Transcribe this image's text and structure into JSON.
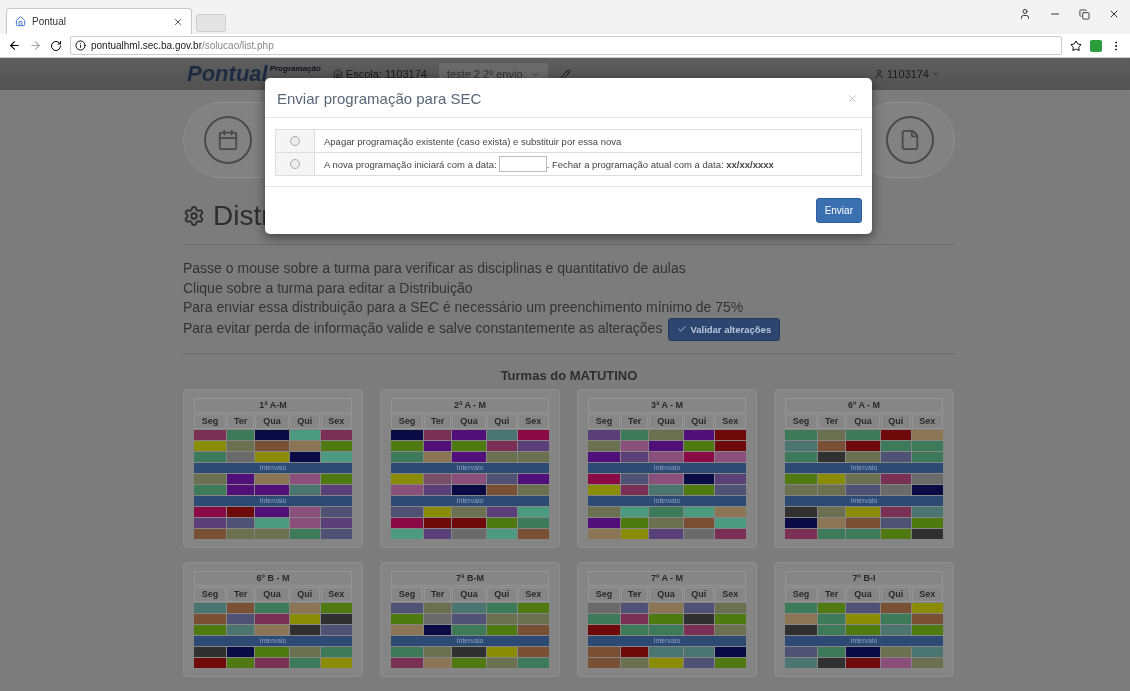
{
  "browser": {
    "tab_title": "Pontual",
    "url_host": "pontualhml.sec.ba.gov.br",
    "url_path": "/solucao/list.php"
  },
  "navbar": {
    "brand": "Pontual",
    "brand_sub": "Programação",
    "school": "Escola: 1103174",
    "select_value": "teste 2 2º envio",
    "user": "1103174"
  },
  "heading": "Distr",
  "instructions": [
    "Passe o mouse sobre a turma para verificar as disciplinas e quantitativo de aulas",
    "Clique sobre a turma para editar a Distribuição",
    "Para enviar essa distribuição para a SEC é necessário um preenchimento mínimo de 75%",
    "Para evitar perda de informação valide e salve constantemente as alterações"
  ],
  "validate_button": "Validar alterações",
  "section_title": "Turmas do MATUTINO",
  "cards": [
    {
      "title": "1ª A-M",
      "days": [
        "Seg",
        "Ter",
        "Qua",
        "Qui",
        "Sex"
      ],
      "rows": [
        {
          "kind": "slot",
          "cells": [
            {
              "color": "#7a2f55"
            },
            {
              "color": "#3d7a5a"
            },
            {
              "color": "#0a0a45"
            },
            {
              "color": "#4c9a80"
            },
            {
              "color": "#7a2f55"
            }
          ]
        },
        {
          "kind": "slot",
          "cells": [
            {
              "color": "#8a8c05"
            },
            {
              "color": "#6a7050"
            },
            {
              "color": "#7a5035"
            },
            {
              "color": "#8c7555"
            },
            {
              "color": "#4f7a12"
            }
          ]
        },
        {
          "kind": "slot",
          "cells": [
            {
              "color": "#3d7a5a"
            },
            {
              "color": "#6a6a6a"
            },
            {
              "color": "#8a8c05"
            },
            {
              "color": "#0a0a45"
            },
            {
              "color": "#4c9a80"
            }
          ]
        },
        {
          "kind": "break",
          "label": "Intervalo"
        },
        {
          "kind": "slot",
          "cells": [
            {
              "color": "#6a7050"
            },
            {
              "color": "#510f7a"
            },
            {
              "color": "#8c7555"
            },
            {
              "color": "#8a4f7a"
            },
            {
              "color": "#4f7a12"
            }
          ]
        },
        {
          "kind": "slot",
          "cells": [
            {
              "color": "#3d7a5a"
            },
            {
              "color": "#510f7a"
            },
            {
              "color": "#510f7a"
            },
            {
              "color": "#4a7570"
            },
            {
              "color": "#5a3f78"
            }
          ]
        },
        {
          "kind": "break",
          "label": "Intervalo"
        },
        {
          "kind": "slot",
          "cells": [
            {
              "color": "#8a0a45"
            },
            {
              "color": "#6e0a0a"
            },
            {
              "color": "#510f7a"
            },
            {
              "color": "#8a4f7a"
            },
            {
              "color": "#4f5275"
            }
          ]
        },
        {
          "kind": "slot",
          "cells": [
            {
              "color": "#5a3f78"
            },
            {
              "color": "#4f5275"
            },
            {
              "color": "#4c9a80"
            },
            {
              "color": "#8a4f7a"
            },
            {
              "color": "#5a3f78"
            }
          ]
        },
        {
          "kind": "slot",
          "cells": [
            {
              "color": "#7a5035"
            },
            {
              "color": "#6a7050"
            },
            {
              "color": "#6a7050"
            },
            {
              "color": "#3d7a5a"
            },
            {
              "color": "#4f5275"
            }
          ]
        }
      ]
    },
    {
      "title": "2ª A - M",
      "days": [
        "Seg",
        "Ter",
        "Qua",
        "Qui",
        "Sex"
      ],
      "rows": [
        {
          "kind": "slot",
          "cells": [
            {
              "color": "#0a0a45"
            },
            {
              "color": "#7a2f55"
            },
            {
              "color": "#510f7a"
            },
            {
              "color": "#4a7570"
            },
            {
              "color": "#8a0a45"
            }
          ]
        },
        {
          "kind": "slot",
          "cells": [
            {
              "color": "#4f7a12"
            },
            {
              "color": "#510f7a"
            },
            {
              "color": "#4f7a12"
            },
            {
              "color": "#7a2f55"
            },
            {
              "color": "#5a3f78"
            }
          ]
        },
        {
          "kind": "slot",
          "cells": [
            {
              "color": "#3d7a5a"
            },
            {
              "color": "#8c7555"
            },
            {
              "color": "#510f7a"
            },
            {
              "color": "#6a7050"
            },
            {
              "color": "#6a7050"
            }
          ]
        },
        {
          "kind": "break",
          "label": "Intervalo"
        },
        {
          "kind": "slot",
          "cells": [
            {
              "color": "#8a8c05"
            },
            {
              "color": "#7a4f6a"
            },
            {
              "color": "#8a4f7a"
            },
            {
              "color": "#4f5275"
            },
            {
              "color": "#510f7a"
            }
          ]
        },
        {
          "kind": "slot",
          "cells": [
            {
              "color": "#8a4f7a"
            },
            {
              "color": "#5a3f78"
            },
            {
              "color": "#0a0a45"
            },
            {
              "color": "#7a5035"
            },
            {
              "color": "#6a7050"
            }
          ]
        },
        {
          "kind": "break",
          "label": "Intervalo"
        },
        {
          "kind": "slot",
          "cells": [
            {
              "color": "#4f5275"
            },
            {
              "color": "#8a8c05"
            },
            {
              "color": "#6a7050"
            },
            {
              "color": "#5a3f78"
            },
            {
              "color": "#4c9a80"
            }
          ]
        },
        {
          "kind": "slot",
          "cells": [
            {
              "color": "#8a0a45"
            },
            {
              "color": "#6e0a0a"
            },
            {
              "color": "#6e0a0a"
            },
            {
              "color": "#4f7a12"
            },
            {
              "color": "#3d7a5a"
            }
          ]
        },
        {
          "kind": "slot",
          "cells": [
            {
              "color": "#4c9a80"
            },
            {
              "color": "#5a3f78"
            },
            {
              "color": "#6a6a6a"
            },
            {
              "color": "#4c9a80"
            },
            {
              "color": "#7a5035"
            }
          ]
        }
      ]
    },
    {
      "title": "3ª A - M",
      "days": [
        "Seg",
        "Ter",
        "Qua",
        "Qui",
        "Sex"
      ],
      "rows": [
        {
          "kind": "slot",
          "cells": [
            {
              "color": "#5a3f78"
            },
            {
              "color": "#3d7a5a"
            },
            {
              "color": "#6a7050"
            },
            {
              "color": "#510f7a"
            },
            {
              "color": "#6e0a0a"
            }
          ]
        },
        {
          "kind": "slot",
          "cells": [
            {
              "color": "#6a7050"
            },
            {
              "color": "#8a4f7a"
            },
            {
              "color": "#510f7a"
            },
            {
              "color": "#4f7a12"
            },
            {
              "color": "#6e0a0a"
            }
          ]
        },
        {
          "kind": "slot",
          "cells": [
            {
              "color": "#510f7a"
            },
            {
              "color": "#5a3f78"
            },
            {
              "color": "#8a4f7a"
            },
            {
              "color": "#8a0a45"
            },
            {
              "color": "#8a4f7a"
            }
          ]
        },
        {
          "kind": "break",
          "label": "Intervalo"
        },
        {
          "kind": "slot",
          "cells": [
            {
              "color": "#8a0a45"
            },
            {
              "color": "#4f5275"
            },
            {
              "color": "#8a4f7a"
            },
            {
              "color": "#0a0a45"
            },
            {
              "color": "#5a3f78"
            }
          ]
        },
        {
          "kind": "slot",
          "cells": [
            {
              "color": "#8a8c05"
            },
            {
              "color": "#7a2f55"
            },
            {
              "color": "#4a7570"
            },
            {
              "color": "#4f7a12"
            },
            {
              "color": "#4f5275"
            }
          ]
        },
        {
          "kind": "break",
          "label": "Intervalo"
        },
        {
          "kind": "slot",
          "cells": [
            {
              "color": "#6a7050"
            },
            {
              "color": "#4c9a80"
            },
            {
              "color": "#3d7a5a"
            },
            {
              "color": "#4c9a80"
            },
            {
              "color": "#8c7555"
            }
          ]
        },
        {
          "kind": "slot",
          "cells": [
            {
              "color": "#510f7a"
            },
            {
              "color": "#4f7a12"
            },
            {
              "color": "#6a7050"
            },
            {
              "color": "#7a5035"
            },
            {
              "color": "#4c9a80"
            }
          ]
        },
        {
          "kind": "slot",
          "cells": [
            {
              "color": "#8c7555"
            },
            {
              "color": "#8a8c05"
            },
            {
              "color": "#5a3f78"
            },
            {
              "color": "#6a6a6a"
            },
            {
              "color": "#7a2f55"
            }
          ]
        }
      ]
    },
    {
      "title": "6º A - M",
      "days": [
        "Seg",
        "Ter",
        "Qua",
        "Qui",
        "Sex"
      ],
      "rows": [
        {
          "kind": "slot",
          "cells": [
            {
              "color": "#3d7a5a"
            },
            {
              "color": "#6a7050"
            },
            {
              "color": "#3d7a5a"
            },
            {
              "color": "#6e0a0a"
            },
            {
              "color": "#8c7555"
            }
          ]
        },
        {
          "kind": "slot",
          "cells": [
            {
              "color": "#4a7570"
            },
            {
              "color": "#7a5035"
            },
            {
              "color": "#6e0a0a"
            },
            {
              "color": "#3d7a5a"
            },
            {
              "color": "#3d7a5a"
            }
          ]
        },
        {
          "kind": "slot",
          "cells": [
            {
              "color": "#3d7a5a"
            },
            {
              "color": "#303030"
            },
            {
              "color": "#6a7050"
            },
            {
              "color": "#4f5275"
            },
            {
              "color": "#3d7a5a"
            }
          ]
        },
        {
          "kind": "break",
          "label": "Intervalo"
        },
        {
          "kind": "slot",
          "cells": [
            {
              "color": "#4f7a12"
            },
            {
              "color": "#8a8c05"
            },
            {
              "color": "#6a7050"
            },
            {
              "color": "#7a2f55"
            },
            {
              "color": "#6a6a6a"
            }
          ]
        },
        {
          "kind": "slot",
          "cells": [
            {
              "color": "#6a7050"
            },
            {
              "color": "#6a7050"
            },
            {
              "color": "#4f5275"
            },
            {
              "color": "#6a6a6a"
            },
            {
              "color": "#0a0a45"
            }
          ]
        },
        {
          "kind": "break",
          "label": "Intervalo"
        },
        {
          "kind": "slot",
          "cells": [
            {
              "color": "#303030"
            },
            {
              "color": "#6a7050"
            },
            {
              "color": "#8a8c05"
            },
            {
              "color": "#7a2f55"
            },
            {
              "color": "#4a7570"
            }
          ]
        },
        {
          "kind": "slot",
          "cells": [
            {
              "color": "#0a0a45"
            },
            {
              "color": "#8c7555"
            },
            {
              "color": "#7a5035"
            },
            {
              "color": "#4f5275"
            },
            {
              "color": "#4f7a12"
            }
          ]
        },
        {
          "kind": "slot",
          "cells": [
            {
              "color": "#7a2f55"
            },
            {
              "color": "#3d7a5a"
            },
            {
              "color": "#3d7a5a"
            },
            {
              "color": "#4f7a12"
            },
            {
              "color": "#303030"
            }
          ]
        }
      ]
    },
    {
      "title": "6º B - M",
      "days": [
        "Seg",
        "Ter",
        "Qua",
        "Qui",
        "Sex"
      ],
      "rows": [
        {
          "kind": "slot",
          "cells": [
            {
              "color": "#4a7570"
            },
            {
              "color": "#7a5035"
            },
            {
              "color": "#3d7a5a"
            },
            {
              "color": "#8c7555"
            },
            {
              "color": "#4f7a12"
            }
          ]
        },
        {
          "kind": "slot",
          "cells": [
            {
              "color": "#7a5035"
            },
            {
              "color": "#4f5275"
            },
            {
              "color": "#7a2f55"
            },
            {
              "color": "#8a8c05"
            },
            {
              "color": "#303030"
            }
          ]
        },
        {
          "kind": "slot",
          "cells": [
            {
              "color": "#4f7a12"
            },
            {
              "color": "#4a7570"
            },
            {
              "color": "#8c7555"
            },
            {
              "color": "#303030"
            },
            {
              "color": "#4f5275"
            }
          ]
        },
        {
          "kind": "break",
          "label": "Intervalo"
        },
        {
          "kind": "slot",
          "cells": [
            {
              "color": "#303030"
            },
            {
              "color": "#0a0a45"
            },
            {
              "color": "#4f7a12"
            },
            {
              "color": "#6a7050"
            },
            {
              "color": "#3d7a5a"
            }
          ]
        },
        {
          "kind": "slot",
          "cells": [
            {
              "color": "#6e0a0a"
            },
            {
              "color": "#4f7a12"
            },
            {
              "color": "#7a2f55"
            },
            {
              "color": "#3d7a5a"
            },
            {
              "color": "#8a8c05"
            }
          ]
        }
      ]
    },
    {
      "title": "7ª B-M",
      "days": [
        "Seg",
        "Ter",
        "Qua",
        "Qui",
        "Sex"
      ],
      "rows": [
        {
          "kind": "slot",
          "cells": [
            {
              "color": "#4f5275"
            },
            {
              "color": "#6a7050"
            },
            {
              "color": "#4a7570"
            },
            {
              "color": "#3d7a5a"
            },
            {
              "color": "#4f7a12"
            }
          ]
        },
        {
          "kind": "slot",
          "cells": [
            {
              "color": "#4f7a12"
            },
            {
              "color": "#6a6a6a"
            },
            {
              "color": "#4f5275"
            },
            {
              "color": "#6a7050"
            },
            {
              "color": "#6a7050"
            }
          ]
        },
        {
          "kind": "slot",
          "cells": [
            {
              "color": "#8c7555"
            },
            {
              "color": "#0a0a45"
            },
            {
              "color": "#3d7a5a"
            },
            {
              "color": "#4f7a12"
            },
            {
              "color": "#7a5035"
            }
          ]
        },
        {
          "kind": "break",
          "label": "Intervalo"
        },
        {
          "kind": "slot",
          "cells": [
            {
              "color": "#3d7a5a"
            },
            {
              "color": "#6a7050"
            },
            {
              "color": "#303030"
            },
            {
              "color": "#8a8c05"
            },
            {
              "color": "#7a5035"
            }
          ]
        },
        {
          "kind": "slot",
          "cells": [
            {
              "color": "#7a2f55"
            },
            {
              "color": "#8c7555"
            },
            {
              "color": "#4f7a12"
            },
            {
              "color": "#6a7050"
            },
            {
              "color": "#3d7a5a"
            }
          ]
        }
      ]
    },
    {
      "title": "7º A - M",
      "days": [
        "Seg",
        "Ter",
        "Qua",
        "Qui",
        "Sex"
      ],
      "rows": [
        {
          "kind": "slot",
          "cells": [
            {
              "color": "#6a6a6a"
            },
            {
              "color": "#4f5275"
            },
            {
              "color": "#8c7555"
            },
            {
              "color": "#4f5275"
            },
            {
              "color": "#6a7050"
            }
          ]
        },
        {
          "kind": "slot",
          "cells": [
            {
              "color": "#3d7a5a"
            },
            {
              "color": "#7a2f55"
            },
            {
              "color": "#4f7a12"
            },
            {
              "color": "#303030"
            },
            {
              "color": "#4f7a12"
            }
          ]
        },
        {
          "kind": "slot",
          "cells": [
            {
              "color": "#6e0a0a"
            },
            {
              "color": "#3d7a5a"
            },
            {
              "color": "#3d7a5a"
            },
            {
              "color": "#7a2f55"
            },
            {
              "color": "#6a7050"
            }
          ]
        },
        {
          "kind": "break",
          "label": "Intervalo"
        },
        {
          "kind": "slot",
          "cells": [
            {
              "color": "#7a5035"
            },
            {
              "color": "#6e0a0a"
            },
            {
              "color": "#4a7570"
            },
            {
              "color": "#4a7570"
            },
            {
              "color": "#0a0a45"
            }
          ]
        },
        {
          "kind": "slot",
          "cells": [
            {
              "color": "#7a5035"
            },
            {
              "color": "#6a7050"
            },
            {
              "color": "#8a8c05"
            },
            {
              "color": "#4f5275"
            },
            {
              "color": "#4f7a12"
            }
          ]
        }
      ]
    },
    {
      "title": "7º B-I",
      "days": [
        "Seg",
        "Ter",
        "Qua",
        "Qui",
        "Sex"
      ],
      "rows": [
        {
          "kind": "slot",
          "cells": [
            {
              "color": "#3d7a5a"
            },
            {
              "color": "#4f7a12"
            },
            {
              "color": "#4f5275"
            },
            {
              "color": "#7a5035"
            },
            {
              "color": "#8a8c05"
            }
          ]
        },
        {
          "kind": "slot",
          "cells": [
            {
              "color": "#8c7555"
            },
            {
              "color": "#3d7a5a"
            },
            {
              "color": "#8a8c05"
            },
            {
              "color": "#3d7a5a"
            },
            {
              "color": "#7a5035"
            }
          ]
        },
        {
          "kind": "slot",
          "cells": [
            {
              "color": "#303030"
            },
            {
              "color": "#3d7a5a"
            },
            {
              "color": "#4f7a12"
            },
            {
              "color": "#4a7570"
            },
            {
              "color": "#4f7a12"
            }
          ]
        },
        {
          "kind": "break",
          "label": "Intervalo"
        },
        {
          "kind": "slot",
          "cells": [
            {
              "color": "#4f5275"
            },
            {
              "color": "#3d7a5a"
            },
            {
              "color": "#0a0a45"
            },
            {
              "color": "#6a7050"
            },
            {
              "color": "#4a7570"
            }
          ]
        },
        {
          "kind": "slot",
          "cells": [
            {
              "color": "#4a7570"
            },
            {
              "color": "#303030"
            },
            {
              "color": "#6e0a0a"
            },
            {
              "color": "#8a4f7a"
            },
            {
              "color": "#6a7050"
            }
          ]
        }
      ]
    }
  ],
  "modal": {
    "title": "Enviar programação para SEC",
    "options": [
      {
        "kind": "text",
        "selected": false,
        "text": "Apagar programação existente (caso exista) e substituir por essa nova"
      },
      {
        "kind": "date",
        "selected": false,
        "text": "A nova programação iniciará com a data:",
        "text_after": ". Fechar a programação atual com a data: **xx/xx/xxxx**"
      }
    ],
    "button": "Enviar"
  }
}
